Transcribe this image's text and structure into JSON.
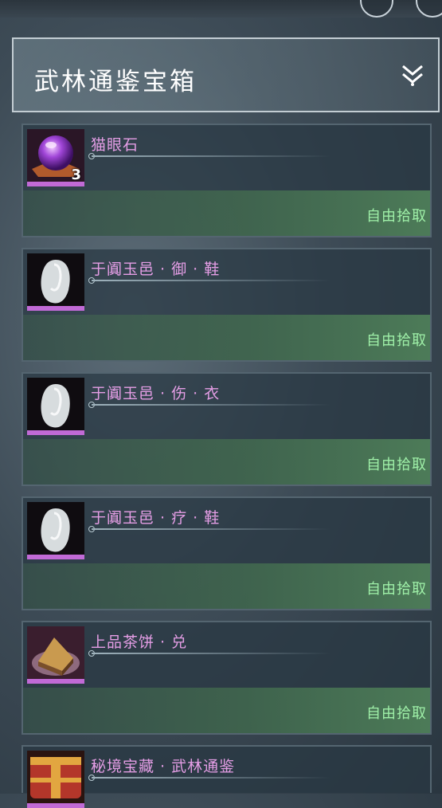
{
  "panel": {
    "title": "武林通鉴宝箱",
    "collapse_icon": "double-chevron-down-icon"
  },
  "items": [
    {
      "name": "猫眼石",
      "quantity": "3",
      "action": "自由拾取",
      "icon": "cat-eye-gem-icon"
    },
    {
      "name": "于阗玉邑 · 御 · 鞋",
      "action": "自由拾取",
      "icon": "white-jade-icon"
    },
    {
      "name": "于阗玉邑 · 伤 · 衣",
      "action": "自由拾取",
      "icon": "white-jade-icon"
    },
    {
      "name": "于阗玉邑 · 疗 · 鞋",
      "action": "自由拾取",
      "icon": "white-jade-icon"
    },
    {
      "name": "上品茶饼 · 兑",
      "action": "自由拾取",
      "icon": "tea-cake-icon"
    },
    {
      "name": "秘境宝藏 · 武林通鉴",
      "icon": "treasure-chest-icon"
    }
  ],
  "colors": {
    "item_name": "#e59ee6",
    "action_text": "#9ff0a8",
    "rarity_bar": "#c16ad6"
  }
}
